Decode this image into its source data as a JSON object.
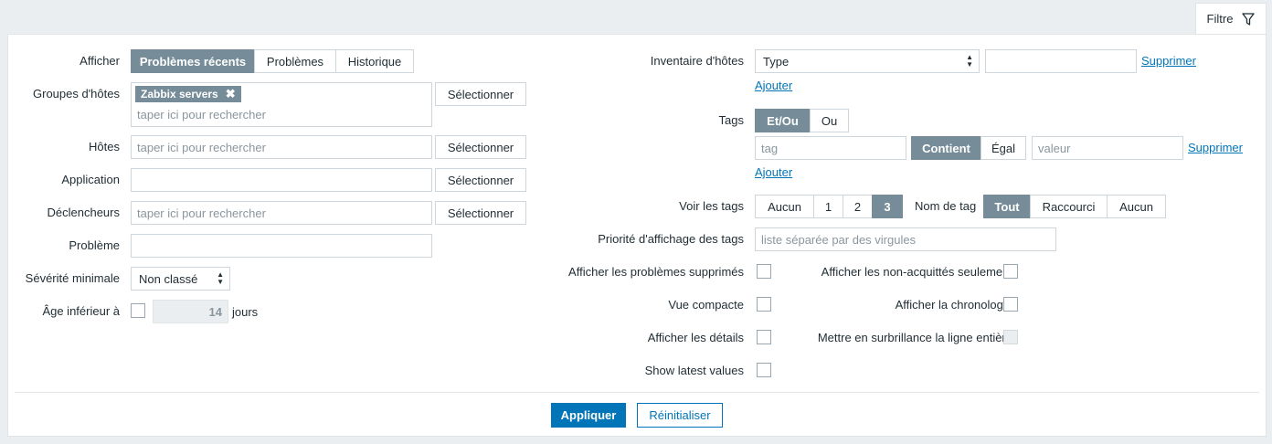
{
  "filter_tab": {
    "label": "Filtre",
    "icon": "filter-icon"
  },
  "left": {
    "afficher": {
      "label": "Afficher",
      "options": [
        "Problèmes récents",
        "Problèmes",
        "Historique"
      ],
      "selected": 0
    },
    "groupes": {
      "label": "Groupes d'hôtes",
      "chip": "Zabbix servers",
      "placeholder": "taper ici pour rechercher",
      "button": "Sélectionner"
    },
    "hotes": {
      "label": "Hôtes",
      "placeholder": "taper ici pour rechercher",
      "button": "Sélectionner"
    },
    "application": {
      "label": "Application",
      "value": "",
      "button": "Sélectionner"
    },
    "declencheurs": {
      "label": "Déclencheurs",
      "placeholder": "taper ici pour rechercher",
      "button": "Sélectionner"
    },
    "probleme": {
      "label": "Problème",
      "value": ""
    },
    "severite": {
      "label": "Sévérité minimale",
      "value": "Non classé"
    },
    "age": {
      "label": "Âge inférieur à",
      "value": "14",
      "unit": "jours"
    }
  },
  "right": {
    "inventaire": {
      "label": "Inventaire d'hôtes",
      "select": "Type",
      "value": "",
      "remove": "Supprimer",
      "add": "Ajouter"
    },
    "tags": {
      "label": "Tags",
      "operators": [
        "Et/Ou",
        "Ou"
      ],
      "selected_operator": 0,
      "tag_placeholder": "tag",
      "match": [
        "Contient",
        "Égal"
      ],
      "selected_match": 0,
      "value_placeholder": "valeur",
      "remove": "Supprimer",
      "add": "Ajouter"
    },
    "voir_tags": {
      "label": "Voir les tags",
      "options": [
        "Aucun",
        "1",
        "2",
        "3"
      ],
      "selected": 3
    },
    "nom_tag": {
      "label": "Nom de tag",
      "options": [
        "Tout",
        "Raccourci",
        "Aucun"
      ],
      "selected": 0
    },
    "priorite": {
      "label": "Priorité d'affichage des tags",
      "placeholder": "liste séparée par des virgules"
    },
    "checks": {
      "supprimes": "Afficher les problèmes supprimés",
      "non_acquittes": "Afficher les non-acquittés seulement",
      "compacte": "Vue compacte",
      "chronologie": "Afficher la chronologie",
      "details": "Afficher les détails",
      "surbrillance": "Mettre en surbrillance la ligne entière",
      "latest": "Show latest values"
    }
  },
  "actions": {
    "apply": "Appliquer",
    "reset": "Réinitialiser"
  }
}
